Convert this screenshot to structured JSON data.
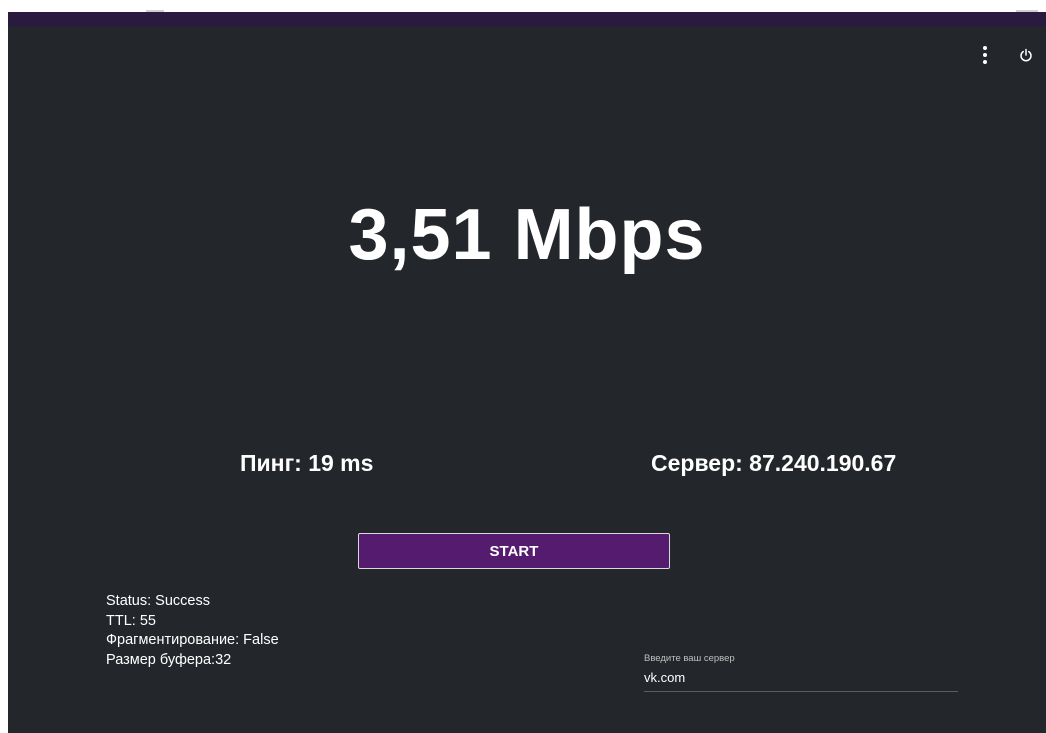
{
  "header": {
    "menu_icon": "more-vertical-icon",
    "power_icon": "power-icon"
  },
  "speed": {
    "text": "3,51 Mbps"
  },
  "stats": {
    "ping": "Пинг: 19 ms",
    "server": "Сервер: 87.240.190.67"
  },
  "start_button": {
    "label": "START"
  },
  "status": {
    "status": "Status: Success",
    "ttl": "TTL: 55",
    "fragmentation": "Фрагментирование: False",
    "buffer": "Размер буфера:32"
  },
  "server_input": {
    "label": "Введите ваш сервер",
    "value": "vk.com"
  },
  "colors": {
    "accent": "#541b6e",
    "background": "#23272b",
    "topbar": "#2a1a40"
  }
}
